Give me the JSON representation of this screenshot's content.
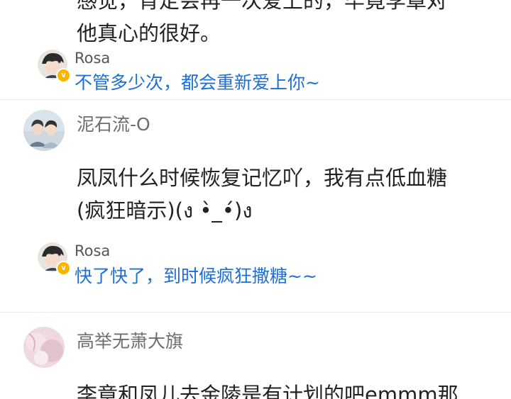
{
  "comments": [
    {
      "text_line1": "感觉，肯定会再一次爱上的，毕竟李章对",
      "text_line2": "他真心的很好。",
      "reply": {
        "author": "Rosa",
        "text": "不管多少次，都会重新爱上你~"
      }
    },
    {
      "author": "泥石流-O",
      "text_line1": "凤凤什么时候恢复记忆吖，我有点低血糖",
      "text_line2": "(疯狂暗示)(ง •̀_•́)ง",
      "reply": {
        "author": "Rosa",
        "text": "快了快了，到时候疯狂撒糖~~"
      }
    },
    {
      "author": "高举无萧大旗",
      "text_line1": "李章和凤儿去金陵是有计划的吧emmm那"
    }
  ],
  "badge": {
    "label": "v",
    "color": "#f5b800"
  },
  "colors": {
    "reply_text": "#1e6fd6",
    "username": "#6e6e6e",
    "body_text": "#222222"
  }
}
